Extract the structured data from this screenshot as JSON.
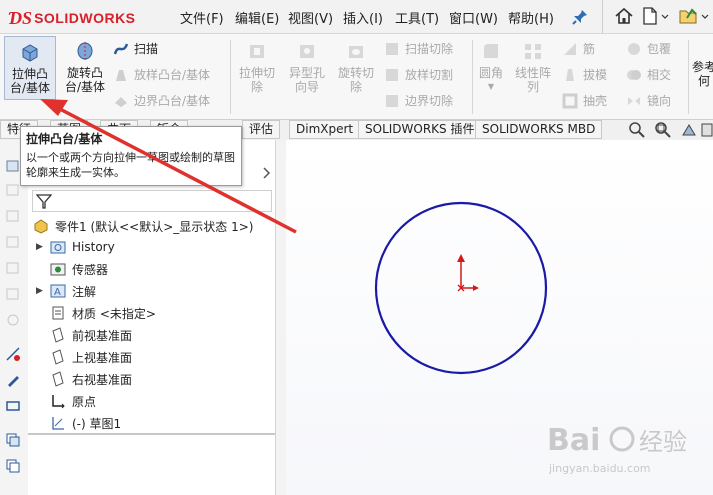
{
  "app": {
    "logo_text": "SOLIDWORKS",
    "brand_color": "#d6202a"
  },
  "menu": {
    "items": [
      "文件(F)",
      "编辑(E)",
      "视图(V)",
      "插入(I)",
      "工具(T)",
      "窗口(W)",
      "帮助(H)"
    ]
  },
  "ribbon": {
    "extrude_boss": "拉伸凸\n台/基体",
    "revolve_boss": "旋转凸\n台/基体",
    "sweep": "扫描",
    "loft_boss": "放样凸台/基体",
    "boundary_boss": "边界凸台/基体",
    "extrude_cut": "拉伸切\n除",
    "hole_wizard": "异型孔\n向导",
    "revolve_cut": "旋转切\n除",
    "swept_cut": "扫描切除",
    "lofted_cut": "放样切割",
    "boundary_cut": "边界切除",
    "fillet": "圆角",
    "linear_pattern": "线性阵\n列",
    "rib": "筋",
    "draft": "拔模",
    "shell": "抽壳",
    "wrap": "包覆",
    "intersect": "相交",
    "mirror": "镜向",
    "reference_geometry": "参考\n何"
  },
  "tabs": [
    "特征",
    "草图",
    "曲面",
    "钣金",
    "评估",
    "DimXpert",
    "SOLIDWORKS 插件",
    "SOLIDWORKS MBD"
  ],
  "tooltip": {
    "title": "拉伸凸台/基体",
    "desc": "以一个或两个方向拉伸一草图或绘制的草图轮廓来生成一实体。"
  },
  "tree": {
    "root": "零件1  (默认<<默认>_显示状态 1>)",
    "items": [
      "History",
      "传感器",
      "注解",
      "材质 <未指定>",
      "前视基准面",
      "上视基准面",
      "右视基准面",
      "原点",
      "(-) 草图1"
    ]
  },
  "sketch": {
    "circle_color": "#1a1aa6",
    "axis_color": "#d11a1a"
  },
  "watermark": {
    "brand": "Bai",
    "brand2": "经验",
    "url": "jingyan.baidu.com"
  }
}
